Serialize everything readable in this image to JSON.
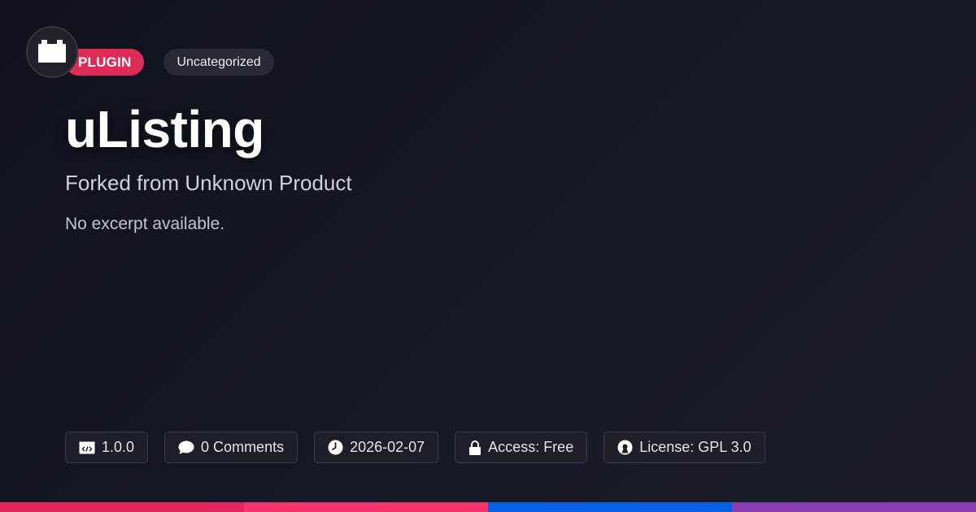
{
  "icon": {
    "name": "plugin-block-icon",
    "color": "#ffffff"
  },
  "tags": {
    "type_label": "PLUGIN",
    "category_label": "Uncategorized"
  },
  "title": "uListing",
  "subtitle": "Forked from Unknown Product",
  "excerpt": "No excerpt available.",
  "meta": {
    "version": "1.0.0",
    "comments": "0 Comments",
    "date": "2026-02-07",
    "access": "Access: Free",
    "license": "License: GPL 3.0"
  },
  "colors": {
    "accent": "#e02b58",
    "bar": [
      "#e0285a",
      "#f5356a",
      "#0a5fe3",
      "#8a3fb0"
    ]
  }
}
